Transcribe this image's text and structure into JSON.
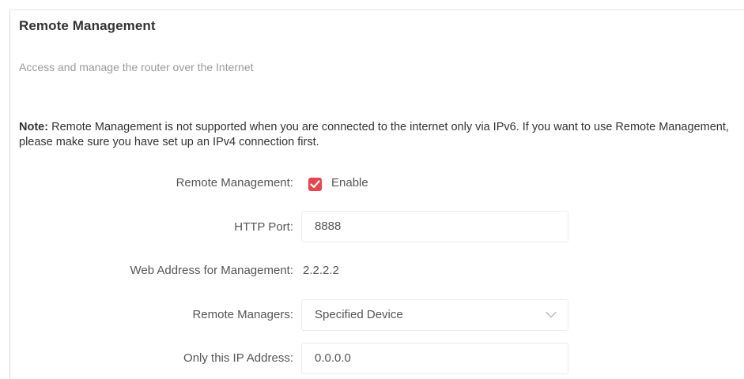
{
  "section": {
    "title": "Remote Management",
    "subtitle": "Access and manage the router over the Internet",
    "note_prefix": "Note:",
    "note_text": " Remote Management is not supported when you are connected to the internet only via IPv6. If you want to use Remote Management, please make sure you have set up an IPv4 connection first."
  },
  "form": {
    "remote_management": {
      "label": "Remote Management:",
      "checkbox_label": "Enable",
      "checked": true
    },
    "http_port": {
      "label": "HTTP Port:",
      "value": "8888"
    },
    "web_address": {
      "label": "Web Address for Management:",
      "value": "2.2.2.2"
    },
    "remote_managers": {
      "label": "Remote Managers:",
      "selected": "Specified Device"
    },
    "only_ip": {
      "label": "Only this IP Address:",
      "value": "0.0.0.0"
    }
  },
  "colors": {
    "accent": "#e8454f"
  },
  "icons": {
    "checkbox": "checkmark-icon",
    "dropdown": "chevron-down-icon"
  }
}
